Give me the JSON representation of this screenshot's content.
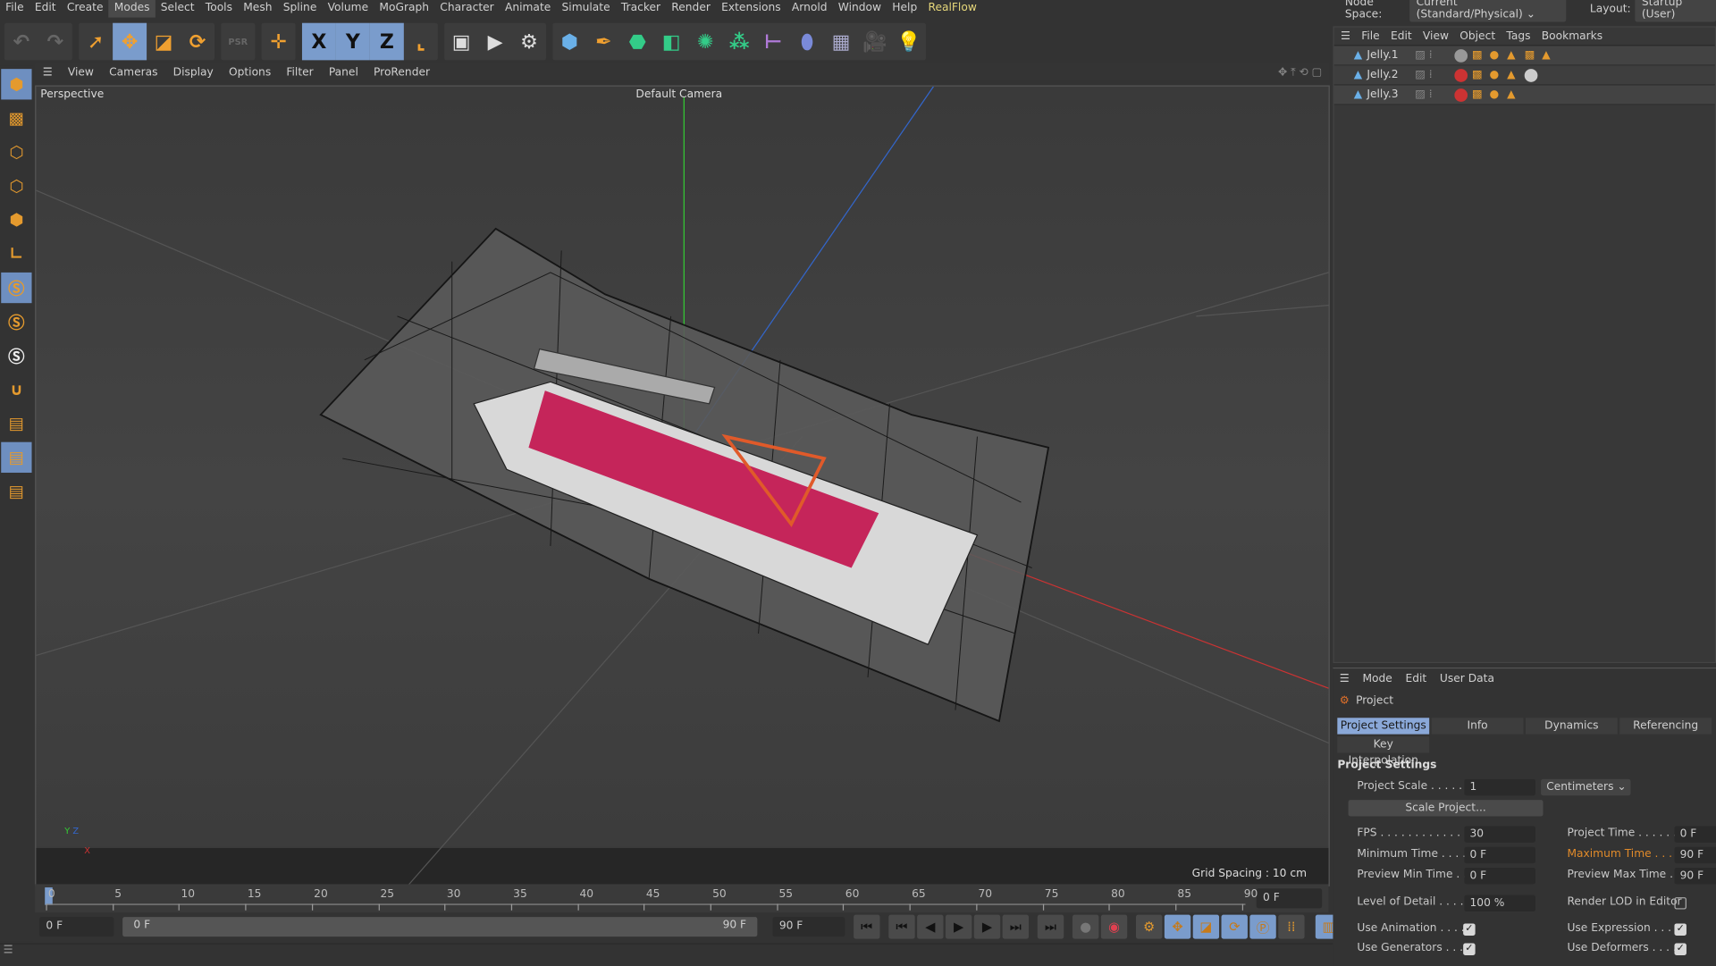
{
  "menu": [
    "File",
    "Edit",
    "Create",
    "Modes",
    "Select",
    "Tools",
    "Mesh",
    "Spline",
    "Volume",
    "MoGraph",
    "Character",
    "Animate",
    "Simulate",
    "Tracker",
    "Render",
    "Extensions",
    "Arnold",
    "Window",
    "Help",
    "RealFlow"
  ],
  "menu_active": "Modes",
  "top_right": {
    "node_space_label": "Node Space:",
    "node_space_value": "Current (Standard/Physical)",
    "layout_label": "Layout:",
    "layout_value": "Startup (User)"
  },
  "toolbar": {
    "axis_x": "X",
    "axis_y": "Y",
    "axis_z": "Z",
    "psr": "PSR"
  },
  "viewport": {
    "menu": [
      "View",
      "Cameras",
      "Display",
      "Options",
      "Filter",
      "Panel",
      "ProRender"
    ],
    "view_name": "Perspective",
    "camera": "Default Camera",
    "grid_spacing": "Grid Spacing : 10 cm",
    "axis_y": "Y",
    "axis_z": "Z",
    "axis_x": "X"
  },
  "timeline": {
    "ticks": [
      "0",
      "5",
      "10",
      "15",
      "20",
      "25",
      "30",
      "35",
      "40",
      "45",
      "50",
      "55",
      "60",
      "65",
      "70",
      "75",
      "80",
      "85",
      "90"
    ],
    "current_frame": "0 F",
    "start_field": "0 F",
    "range_start": "0 F",
    "range_end": "90 F",
    "end_field": "90 F"
  },
  "object_manager": {
    "menu": [
      "File",
      "Edit",
      "View",
      "Object",
      "Tags",
      "Bookmarks"
    ],
    "objects": [
      {
        "name": "Jelly.1"
      },
      {
        "name": "Jelly.2"
      },
      {
        "name": "Jelly.3"
      }
    ]
  },
  "attributes": {
    "menu": [
      "Mode",
      "Edit",
      "User Data"
    ],
    "object": "Project",
    "tabs": [
      "Project Settings",
      "Info",
      "Dynamics",
      "Referencing"
    ],
    "tab2": "Key Interpolation",
    "section": "Project Settings",
    "project_scale_label": "Project Scale . . . . . .",
    "project_scale": "1",
    "units": "Centimeters",
    "scale_button": "Scale Project...",
    "fps_label": "FPS . . . . . . . . . . . . .",
    "fps": "30",
    "project_time_label": "Project Time . . . . . .",
    "project_time": "0 F",
    "min_time_label": "Minimum Time . . . .",
    "min_time": "0 F",
    "max_time_label": "Maximum Time . . .",
    "max_time": "90 F",
    "prev_min_label": "Preview Min Time . .",
    "prev_min": "0 F",
    "prev_max_label": "Preview Max Time . .",
    "prev_max": "90 F",
    "lod_label": "Level of Detail . . . . .",
    "lod": "100 %",
    "render_lod_label": "Render LOD in Editor",
    "render_lod": false,
    "use_anim_label": "Use Animation . . . .",
    "use_anim": true,
    "use_expr_label": "Use Expression . . . .",
    "use_expr": true,
    "use_gen_label": "Use Generators . . . .",
    "use_gen": true,
    "use_def_label": "Use Deformers . . . .",
    "use_def": true
  },
  "colors": {
    "accent": "#7a9ccc",
    "orange": "#e49a2e",
    "highlight": "#e08a2a"
  }
}
